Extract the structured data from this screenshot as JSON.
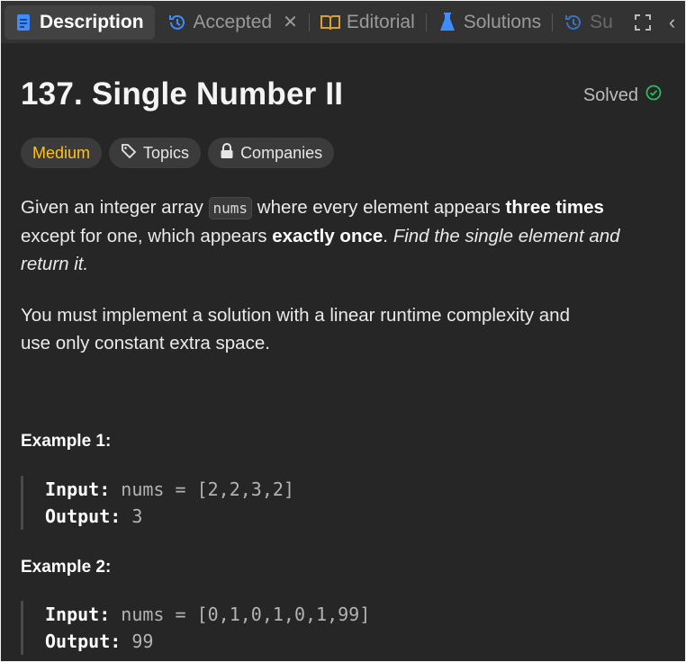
{
  "tabs": [
    {
      "label": "Description",
      "icon": "document-icon",
      "active": true
    },
    {
      "label": "Accepted",
      "icon": "history-icon",
      "closable": true
    },
    {
      "label": "Editorial",
      "icon": "book-icon"
    },
    {
      "label": "Solutions",
      "icon": "flask-icon"
    },
    {
      "label": "Su",
      "icon": "history-icon"
    }
  ],
  "problem": {
    "title": "137. Single Number II",
    "status": "Solved",
    "difficulty": "Medium",
    "topics_label": "Topics",
    "companies_label": "Companies"
  },
  "description": {
    "p1_a": "Given an integer array ",
    "p1_code": "nums",
    "p1_b": " where every element appears ",
    "p1_bold1": "three times",
    "p1_c": " except for one, which appears ",
    "p1_bold2": "exactly once",
    "p1_d": ". ",
    "p1_italic": "Find the single element and return it.",
    "p2": "You must implement a solution with a linear runtime complexity and use only constant extra space."
  },
  "examples": [
    {
      "title": "Example 1:",
      "input_label": "Input:",
      "input": " nums = [2,2,3,2]",
      "output_label": "Output:",
      "output": " 3"
    },
    {
      "title": "Example 2:",
      "input_label": "Input:",
      "input": " nums = [0,1,0,1,0,1,99]",
      "output_label": "Output:",
      "output": " 99"
    }
  ],
  "colors": {
    "background": "#262626",
    "tabbar": "#333333",
    "difficulty_medium": "#ffc01e",
    "solved_check": "#2cbb5d",
    "description_icon": "#3f8cff",
    "accepted_icon": "#3f8cff",
    "editorial_icon": "#d9a033",
    "solutions_icon": "#3f8cff"
  }
}
